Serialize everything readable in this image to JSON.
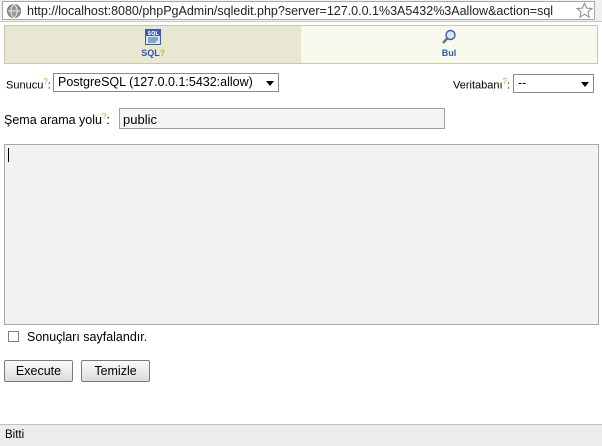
{
  "browser": {
    "url": "http://localhost:8080/phpPgAdmin/sqledit.php?server=127.0.0.1%3A5432%3Aallow&action=sql"
  },
  "tabs": [
    {
      "label": "SQL",
      "icon": "sql-icon",
      "active": true
    },
    {
      "label": "Bul",
      "icon": "magnifier-icon",
      "active": false
    }
  ],
  "help_mark": "?",
  "form": {
    "server_label": "Sunucu",
    "server_value": "PostgreSQL (127.0.0.1:5432:allow)",
    "database_label": "Veritabanı",
    "database_value": "--",
    "schema_label": "Şema arama yolu",
    "schema_value": "public",
    "query_text": "",
    "paginate_label": "Sonuçları sayfalandır.",
    "paginate_checked": false
  },
  "buttons": {
    "execute": "Execute",
    "clear": "Temizle"
  },
  "status": {
    "text": "Bitti"
  }
}
